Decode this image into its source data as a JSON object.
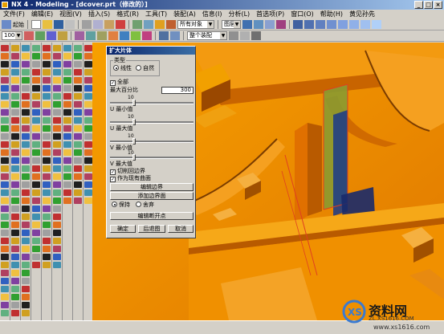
{
  "window": {
    "title": "NX 4 - Modeling - [dcover.prt（修改的）]",
    "controls": [
      "_",
      "□",
      "×"
    ]
  },
  "menu": [
    "文件(F)",
    "编辑(E)",
    "视图(V)",
    "插入(S)",
    "格式(R)",
    "工具(T)",
    "装配(A)",
    "信息(I)",
    "分析(L)",
    "首选项(P)",
    "窗口(O)",
    "帮助(H)",
    "黄见孙先"
  ],
  "toolbar1": {
    "start_label": "起始",
    "filter_placeholder": "所有对象",
    "layer_label": "图层"
  },
  "toolbar2": {
    "zoom_value": "100",
    "snap_placeholder": "整个装配"
  },
  "dialog": {
    "title": "扩大片体",
    "type_group": "类型",
    "type_linear": "线性",
    "type_natural": "自然",
    "all_label": "全部",
    "max_percent_label": "最大百分比",
    "max_percent_value": "300",
    "u_min_label": "U 最小值",
    "u_min_value": "10",
    "u_max_label": "U 最大值",
    "u_max_value": "10",
    "v_min_label": "V 最小值",
    "v_min_value": "10",
    "v_max_label": "V 最大值",
    "v_max_value": "10",
    "trim_boundary_label": "切削回边界",
    "as_copy_label": "作为现有曲面",
    "edit_boundary_button": "编辑边界",
    "add_boundary_button": "添加边界面",
    "keep_label": "保持",
    "discard_label": "舍弃",
    "edit_break_points_button": "编辑断开点",
    "ok_button": "确定",
    "back_button": "后退图",
    "cancel_button": "取消",
    "all_checked": true,
    "trim_checked": true,
    "as_copy_checked": true,
    "type_selected": "linear",
    "keep_selected": "keep"
  },
  "watermark": {
    "brand_cn": "资料网",
    "brand_url": "ZL.XS1616.COM",
    "site_url": "www.xs1616.com"
  },
  "colors": {
    "model_orange": "#f08c00",
    "sheet_green": "#8a9a30",
    "title_blue": "#0a246a"
  }
}
